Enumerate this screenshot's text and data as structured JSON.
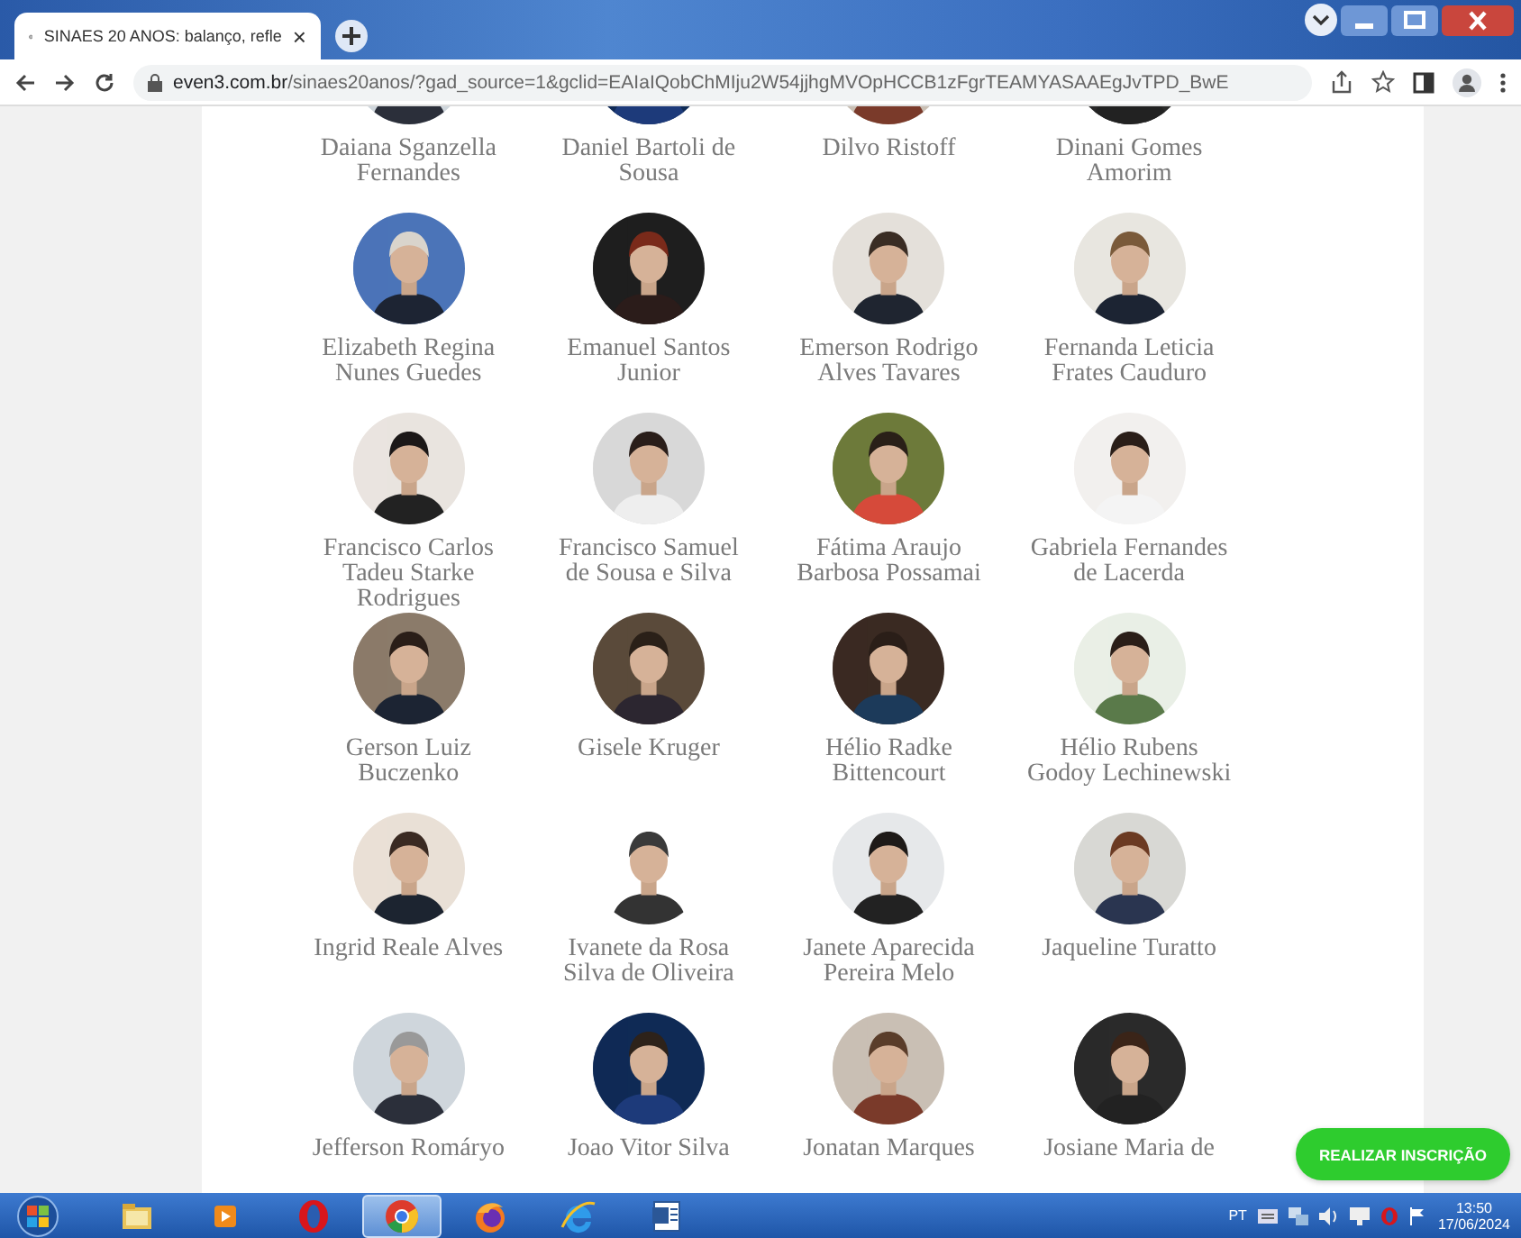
{
  "browser": {
    "tab": {
      "title": "SINAES 20 ANOS: balanço, refle",
      "close": "×"
    },
    "url": {
      "host": "even3.com.br",
      "path": "/sinaes20anos/?gad_source=1&gclid=EAIaIQobChMIju2W54jjhgMVOpHCCB1zFgrTEAMYASAAEgJvTPD_BwE"
    }
  },
  "speakers": [
    {
      "name": "Daiana Sganzella\nFernandes"
    },
    {
      "name": "Daniel Bartoli de\nSousa"
    },
    {
      "name": "Dilvo Ristoff"
    },
    {
      "name": "Dinani Gomes\nAmorim"
    },
    {
      "name": "Elizabeth Regina\nNunes Guedes"
    },
    {
      "name": "Emanuel Santos\nJunior"
    },
    {
      "name": "Emerson Rodrigo\nAlves Tavares"
    },
    {
      "name": "Fernanda Leticia\nFrates Cauduro"
    },
    {
      "name": "Francisco Carlos\nTadeu Starke\nRodrigues"
    },
    {
      "name": "Francisco Samuel\nde Sousa e Silva"
    },
    {
      "name": "Fátima Araujo\nBarbosa Possamai"
    },
    {
      "name": "Gabriela Fernandes\nde Lacerda"
    },
    {
      "name": "Gerson Luiz\nBuczenko"
    },
    {
      "name": "Gisele Kruger"
    },
    {
      "name": "Hélio Radke\nBittencourt"
    },
    {
      "name": "Hélio Rubens\nGodoy Lechinewski"
    },
    {
      "name": "Ingrid Reale Alves"
    },
    {
      "name": "Ivanete da Rosa\nSilva de Oliveira"
    },
    {
      "name": "Janete Aparecida\nPereira Melo"
    },
    {
      "name": "Jaqueline Turatto"
    },
    {
      "name": "Jefferson Romáryo"
    },
    {
      "name": "Joao Vitor Silva"
    },
    {
      "name": "Jonatan Marques"
    },
    {
      "name": "Josiane Maria de"
    }
  ],
  "cta_button": "REALIZAR INSCRIÇÃO",
  "taskbar": {
    "apps": [
      {
        "kind": "folder",
        "selected": false
      },
      {
        "kind": "media",
        "selected": false
      },
      {
        "kind": "opera",
        "selected": false
      },
      {
        "kind": "chrome",
        "selected": true
      },
      {
        "kind": "firefox",
        "selected": false
      },
      {
        "kind": "ie",
        "selected": false
      },
      {
        "kind": "word",
        "selected": false
      }
    ],
    "language": "PT",
    "time": "13:50",
    "date": "17/06/2024"
  }
}
